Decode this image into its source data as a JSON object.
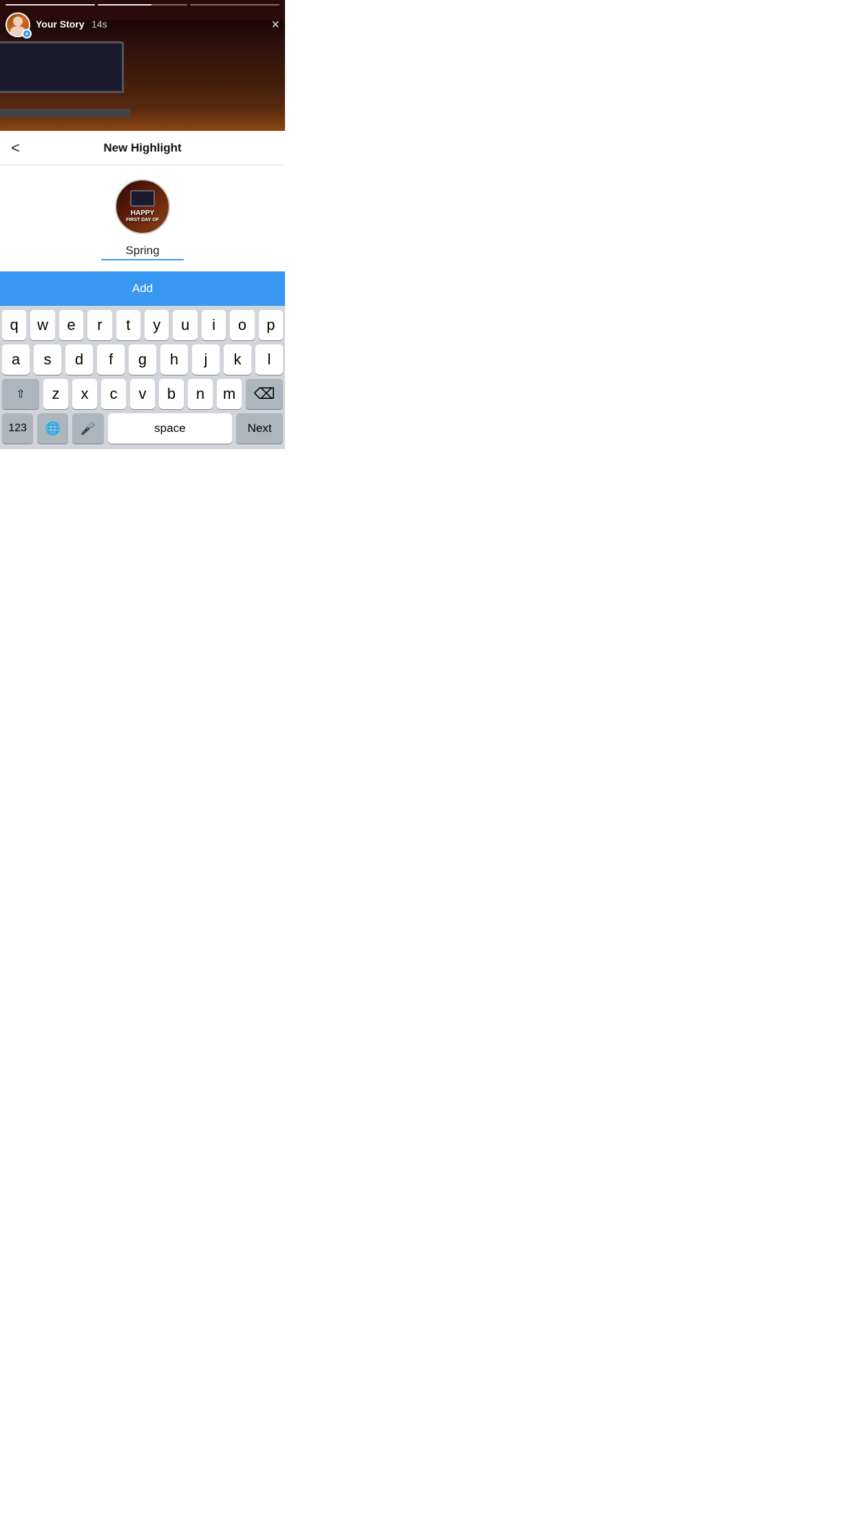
{
  "story": {
    "user_label": "Your Story",
    "duration": "14s",
    "progress_bars": [
      {
        "state": "filled"
      },
      {
        "state": "active"
      },
      {
        "state": "empty"
      }
    ]
  },
  "header": {
    "back_label": "<",
    "title": "New Highlight",
    "close_label": "×"
  },
  "highlight": {
    "thumb_line1": "HAPPY",
    "thumb_line2": "FIRST DAY OF",
    "name_value": "Spring",
    "name_placeholder": "Spring"
  },
  "add_button": {
    "label": "Add"
  },
  "keyboard": {
    "rows": [
      [
        "q",
        "w",
        "e",
        "r",
        "t",
        "y",
        "u",
        "i",
        "o",
        "p"
      ],
      [
        "a",
        "s",
        "d",
        "f",
        "g",
        "h",
        "j",
        "k",
        "l"
      ],
      [
        "z",
        "x",
        "c",
        "v",
        "b",
        "n",
        "m"
      ]
    ],
    "bottom": {
      "numbers": "123",
      "space": "space",
      "next": "Next"
    }
  }
}
